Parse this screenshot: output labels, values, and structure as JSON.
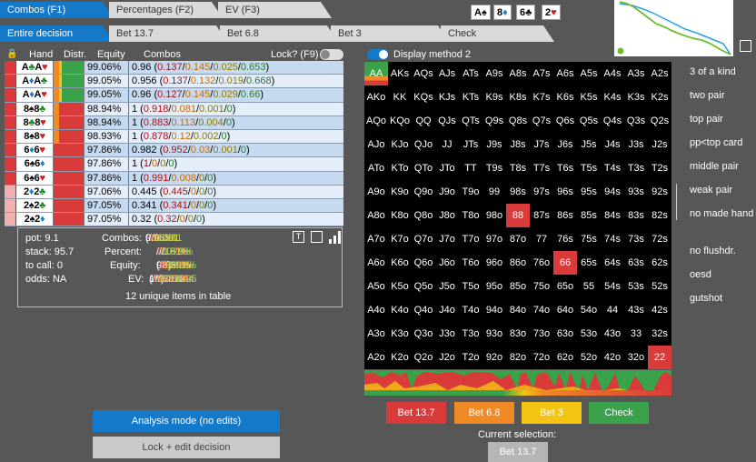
{
  "tabs_top": [
    {
      "label": "Combos (F1)",
      "active": true
    },
    {
      "label": "Percentages (F2)",
      "active": false
    },
    {
      "label": "EV (F3)",
      "active": false
    }
  ],
  "tabs_second": [
    {
      "label": "Entire decision",
      "active": true
    },
    {
      "label": "Bet 13.7",
      "active": false
    },
    {
      "label": "Bet 6.8",
      "active": false
    },
    {
      "label": "Bet 3",
      "active": false
    },
    {
      "label": "Check",
      "active": false
    }
  ],
  "board": [
    {
      "rank": "A",
      "suit": "♠"
    },
    {
      "rank": "8",
      "suit": "♦"
    },
    {
      "rank": "6",
      "suit": "♣"
    },
    {
      "rank": "2",
      "suit": "♥"
    }
  ],
  "table": {
    "headers": {
      "hand": "Hand",
      "distr": "Distr.",
      "equity": "Equity",
      "combos": "Combos",
      "lock": "Lock? (F9)"
    },
    "rows": [
      {
        "hand": "A♣A♥",
        "equity": "99.06%",
        "c0": "0.96",
        "c1": "0.137",
        "c2": "0.145",
        "c3": "0.025",
        "c4": "0.653"
      },
      {
        "hand": "A♦A♣",
        "equity": "99.05%",
        "c0": "0.956",
        "c1": "0.137",
        "c2": "0.132",
        "c3": "0.019",
        "c4": "0.668"
      },
      {
        "hand": "A♦A♥",
        "equity": "99.05%",
        "c0": "0.96",
        "c1": "0.127",
        "c2": "0.145",
        "c3": "0.029",
        "c4": "0.66"
      },
      {
        "hand": "8♠8♣",
        "equity": "98.94%",
        "c0": "1",
        "c1": "0.918",
        "c2": "0.081",
        "c3": "0.001",
        "c4": "0"
      },
      {
        "hand": "8♣8♥",
        "equity": "98.94%",
        "c0": "1",
        "c1": "0.883",
        "c2": "0.113",
        "c3": "0.004",
        "c4": "0"
      },
      {
        "hand": "8♠8♥",
        "equity": "98.93%",
        "c0": "1",
        "c1": "0.878",
        "c2": "0.12",
        "c3": "0.002",
        "c4": "0"
      },
      {
        "hand": "6♦6♥",
        "equity": "97.86%",
        "c0": "0.982",
        "c1": "0.952",
        "c2": "0.03",
        "c3": "0.001",
        "c4": "0"
      },
      {
        "hand": "6♠6♦",
        "equity": "97.86%",
        "c0": "1",
        "c1": "1",
        "c2": "0",
        "c3": "0",
        "c4": "0"
      },
      {
        "hand": "6♠6♥",
        "equity": "97.86%",
        "c0": "1",
        "c1": "0.991",
        "c2": "0.008",
        "c3": "0",
        "c4": "0"
      },
      {
        "hand": "2♦2♣",
        "equity": "97.06%",
        "c0": "0.445",
        "c1": "0.445",
        "c2": "0",
        "c3": "0",
        "c4": "0"
      },
      {
        "hand": "2♠2♣",
        "equity": "97.05%",
        "c0": "0.341",
        "c1": "0.341",
        "c2": "0",
        "c3": "0",
        "c4": "0"
      },
      {
        "hand": "2♠2♦",
        "equity": "97.05%",
        "c0": "0.32",
        "c1": "0.32",
        "c2": "0",
        "c3": "0",
        "c4": "0"
      }
    ]
  },
  "summary": {
    "pot": "pot: 9.1",
    "stack": "stack: 95.7",
    "to_call": "to call: 0",
    "odds": "odds: NA",
    "combos_label": "Combos:",
    "combos_total": "9.965",
    "combos_parts": [
      "7.129",
      "0.774",
      "0.081",
      "1.981"
    ],
    "percent_label": "Percent:",
    "percent_parts": [
      "71.5%",
      "7.77%",
      "0.81%",
      "19.9%"
    ],
    "equity_label": "Equity:",
    "equity_total": "98.39%",
    "equity_parts": [
      "98.2%",
      "98.9%",
      "99.0%",
      "99.1%"
    ],
    "ev_label": "EV:",
    "ev_total": "18.3818",
    "ev_parts": [
      "18.6399",
      "18.1383",
      "17.5644",
      "17.4125"
    ],
    "unique_items": "12 unique items in table"
  },
  "display_method": "Display method 2",
  "grid": {
    "rows": [
      [
        "AA",
        "AKs",
        "AQs",
        "AJs",
        "ATs",
        "A9s",
        "A8s",
        "A7s",
        "A6s",
        "A5s",
        "A4s",
        "A3s",
        "A2s"
      ],
      [
        "AKo",
        "KK",
        "KQs",
        "KJs",
        "KTs",
        "K9s",
        "K8s",
        "K7s",
        "K6s",
        "K5s",
        "K4s",
        "K3s",
        "K2s"
      ],
      [
        "AQo",
        "KQo",
        "QQ",
        "QJs",
        "QTs",
        "Q9s",
        "Q8s",
        "Q7s",
        "Q6s",
        "Q5s",
        "Q4s",
        "Q3s",
        "Q2s"
      ],
      [
        "AJo",
        "KJo",
        "QJo",
        "JJ",
        "JTs",
        "J9s",
        "J8s",
        "J7s",
        "J6s",
        "J5s",
        "J4s",
        "J3s",
        "J2s"
      ],
      [
        "ATo",
        "KTo",
        "QTo",
        "JTo",
        "TT",
        "T9s",
        "T8s",
        "T7s",
        "T6s",
        "T5s",
        "T4s",
        "T3s",
        "T2s"
      ],
      [
        "A9o",
        "K9o",
        "Q9o",
        "J9o",
        "T9o",
        "99",
        "98s",
        "97s",
        "96s",
        "95s",
        "94s",
        "93s",
        "92s"
      ],
      [
        "A8o",
        "K8o",
        "Q8o",
        "J8o",
        "T8o",
        "98o",
        "88",
        "87s",
        "86s",
        "85s",
        "84s",
        "83s",
        "82s"
      ],
      [
        "A7o",
        "K7o",
        "Q7o",
        "J7o",
        "T7o",
        "97o",
        "87o",
        "77",
        "76s",
        "75s",
        "74s",
        "73s",
        "72s"
      ],
      [
        "A6o",
        "K6o",
        "Q6o",
        "J6o",
        "T6o",
        "96o",
        "86o",
        "76o",
        "66",
        "65s",
        "64s",
        "63s",
        "62s"
      ],
      [
        "A5o",
        "K5o",
        "Q5o",
        "J5o",
        "T5o",
        "95o",
        "85o",
        "75o",
        "65o",
        "55",
        "54s",
        "53s",
        "52s"
      ],
      [
        "A4o",
        "K4o",
        "Q4o",
        "J4o",
        "T4o",
        "94o",
        "84o",
        "74o",
        "64o",
        "54o",
        "44",
        "43s",
        "42s"
      ],
      [
        "A3o",
        "K3o",
        "Q3o",
        "J3o",
        "T3o",
        "93o",
        "83o",
        "73o",
        "63o",
        "53o",
        "43o",
        "33",
        "32s"
      ],
      [
        "A2o",
        "K2o",
        "Q2o",
        "J2o",
        "T2o",
        "92o",
        "82o",
        "72o",
        "62o",
        "52o",
        "42o",
        "32o",
        "22"
      ]
    ]
  },
  "categories": [
    "3 of a kind",
    "two pair",
    "top pair",
    "pp<top card",
    "middle pair",
    "weak pair",
    "no made hand",
    "no flushdr.",
    "oesd",
    "gutshot"
  ],
  "actions": [
    {
      "label": "Bet 13.7",
      "color": "#d93a3a"
    },
    {
      "label": "Bet 6.8",
      "color": "#f08a24"
    },
    {
      "label": "Bet 3",
      "color": "#f4c414"
    },
    {
      "label": "Check",
      "color": "#3aa24a"
    }
  ],
  "current_selection_label": "Current selection:",
  "current_selection_value": "Bet 13.7",
  "analysis_mode_label": "Analysis mode (no edits)",
  "lock_edit_label": "Lock + edit decision"
}
